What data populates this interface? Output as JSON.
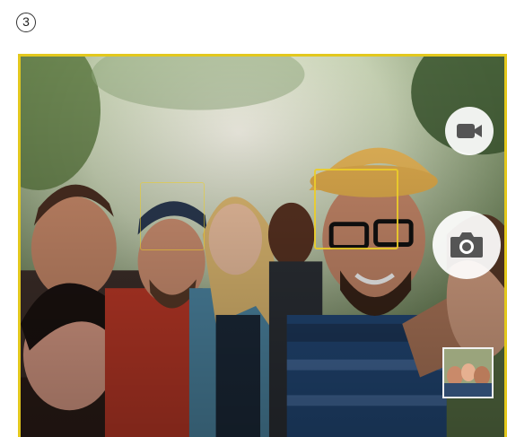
{
  "step": {
    "number_label": "3"
  },
  "camera": {
    "focus_color": "#e3c81d",
    "icons": {
      "video": "video-camera-icon",
      "shutter": "camera-icon",
      "gallery": "gallery-thumbnail"
    }
  }
}
